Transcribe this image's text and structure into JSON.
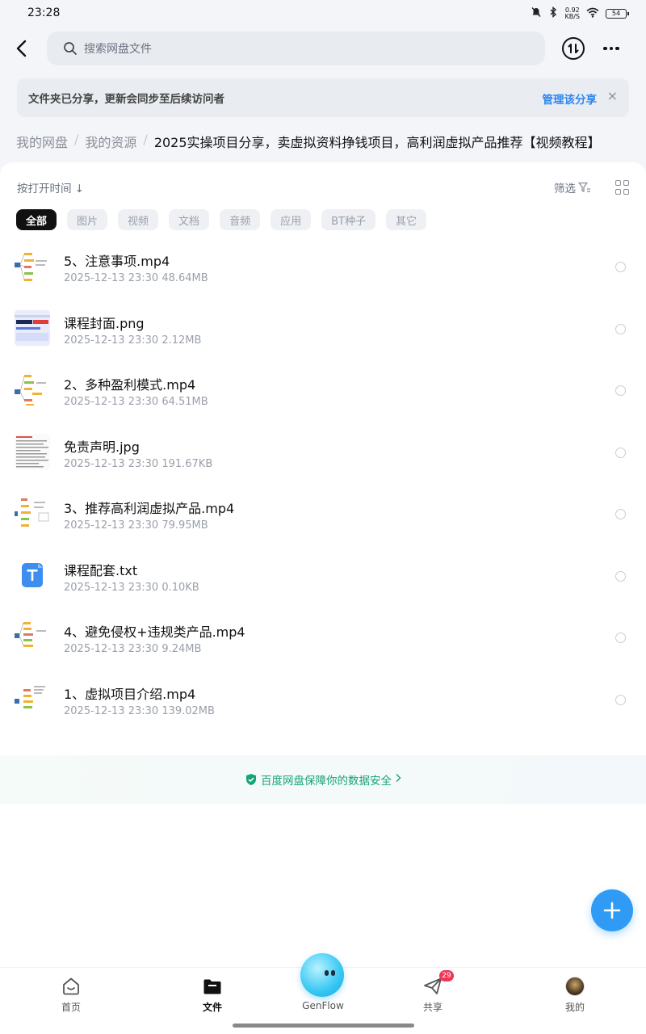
{
  "status_bar": {
    "time": "23:28",
    "net_speed_value": "0.92",
    "net_speed_unit": "KB/S",
    "battery": "54"
  },
  "search": {
    "placeholder": "搜索网盘文件"
  },
  "notice": {
    "text": "文件夹已分享，更新会同步至后续访问者",
    "action": "管理该分享",
    "close": "×"
  },
  "breadcrumb": {
    "items": [
      "我的网盘",
      "我的资源"
    ],
    "separator": "/",
    "current": "2025实操项目分享，卖虚拟资料挣钱项目，高利润虚拟产品推荐【视频教程】"
  },
  "toolbar": {
    "sort": "按打开时间 ↓",
    "filter": "筛选"
  },
  "chips": [
    "全部",
    "图片",
    "视频",
    "文档",
    "音频",
    "应用",
    "BT种子",
    "其它"
  ],
  "files": [
    {
      "name": "5、注意事项.mp4",
      "date": "2025-12-13",
      "time": "23:30",
      "size": "48.64MB",
      "thumb": "mindmap-video"
    },
    {
      "name": "课程封面.png",
      "date": "2025-12-13",
      "time": "23:30",
      "size": "2.12MB",
      "thumb": "cover-image"
    },
    {
      "name": "2、多种盈利模式.mp4",
      "date": "2025-12-13",
      "time": "23:30",
      "size": "64.51MB",
      "thumb": "mindmap-video"
    },
    {
      "name": "免责声明.jpg",
      "date": "2025-12-13",
      "time": "23:30",
      "size": "191.67KB",
      "thumb": "text-image"
    },
    {
      "name": "3、推荐高利润虚拟产品.mp4",
      "date": "2025-12-13",
      "time": "23:30",
      "size": "79.95MB",
      "thumb": "mindmap-video"
    },
    {
      "name": "课程配套.txt",
      "date": "2025-12-13",
      "time": "23:30",
      "size": "0.10KB",
      "thumb": "txt-file"
    },
    {
      "name": "4、避免侵权+违规类产品.mp4",
      "date": "2025-12-13",
      "time": "23:30",
      "size": "9.24MB",
      "thumb": "mindmap-video"
    },
    {
      "name": "1、虚拟项目介绍.mp4",
      "date": "2025-12-13",
      "time": "23:30",
      "size": "139.02MB",
      "thumb": "mindmap-video"
    }
  ],
  "safety_text": "百度网盘保障你的数据安全",
  "bottom_nav": {
    "home": "首页",
    "files": "文件",
    "genflow": "GenFlow",
    "share": "共享",
    "share_badge": "29",
    "mine": "我的"
  },
  "colors": {
    "accent": "#2e86f0",
    "fab": "#2f9bf5",
    "safety": "#17a37a",
    "badge": "#f0365a"
  }
}
